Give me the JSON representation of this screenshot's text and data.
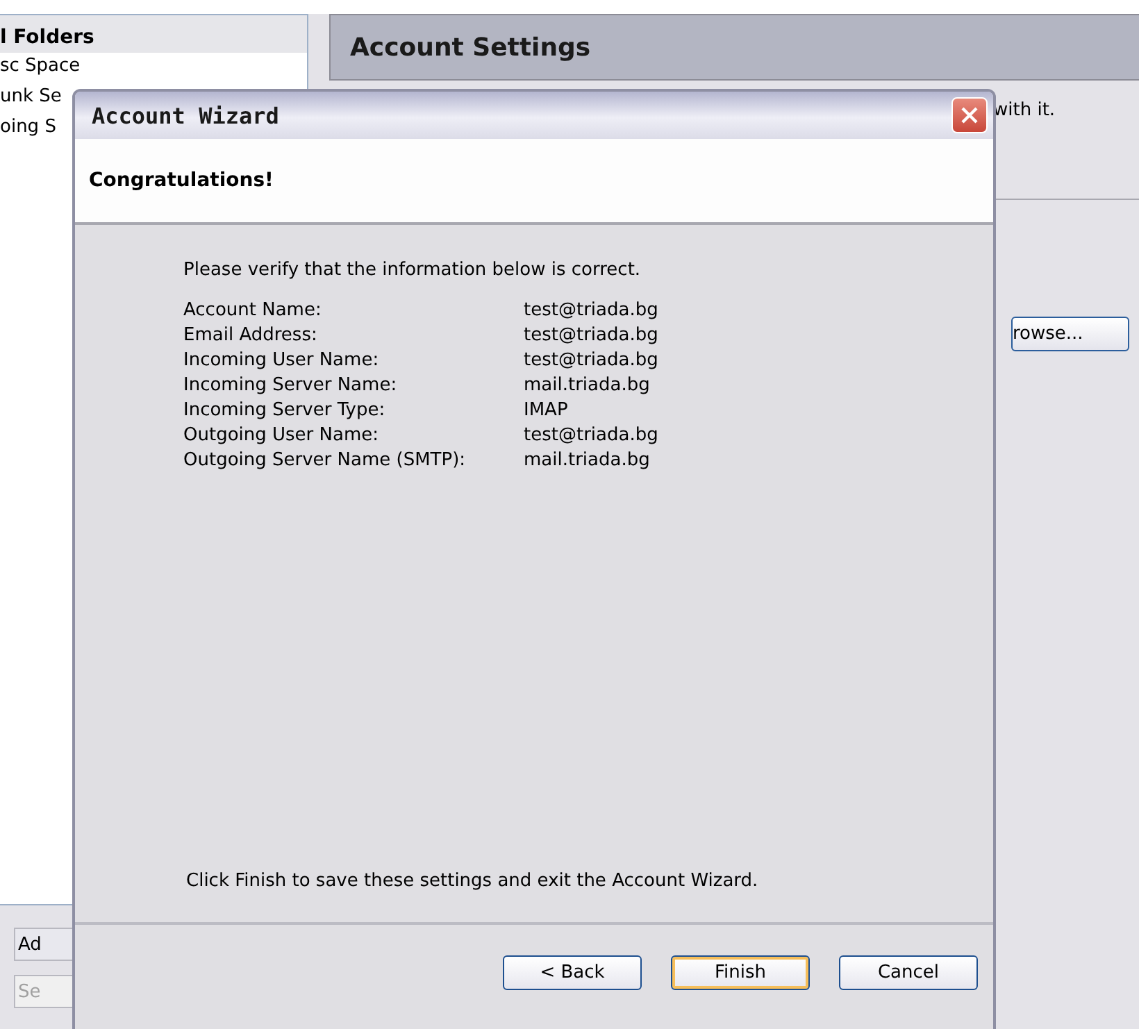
{
  "background": {
    "folder_list": {
      "header": "l Folders",
      "items": [
        "sc Space",
        "unk Se",
        "oing S"
      ]
    },
    "account_settings": {
      "title": "Account Settings",
      "note": "with it.",
      "browse_button": "rowse..."
    },
    "bottom_buttons": [
      {
        "label": "Ad",
        "disabled": false
      },
      {
        "label": "Se",
        "disabled": true
      }
    ]
  },
  "dialog": {
    "title": "Account Wizard",
    "heading": "Congratulations!",
    "intro": "Please verify that the information below is correct.",
    "fields": [
      {
        "label": "Account Name:",
        "value": "test@triada.bg"
      },
      {
        "label": "Email Address:",
        "value": "test@triada.bg"
      },
      {
        "label": "Incoming User Name:",
        "value": "test@triada.bg"
      },
      {
        "label": "Incoming Server Name:",
        "value": "mail.triada.bg"
      },
      {
        "label": "Incoming Server Type:",
        "value": "IMAP"
      },
      {
        "label": "Outgoing User Name:",
        "value": "test@triada.bg"
      },
      {
        "label": "Outgoing Server Name (SMTP):",
        "value": "mail.triada.bg"
      }
    ],
    "footer_text": "Click Finish to save these settings and exit the Account Wizard.",
    "buttons": [
      {
        "label": "< Back",
        "default": false
      },
      {
        "label": "Finish",
        "default": true
      },
      {
        "label": "Cancel",
        "default": false
      }
    ]
  }
}
